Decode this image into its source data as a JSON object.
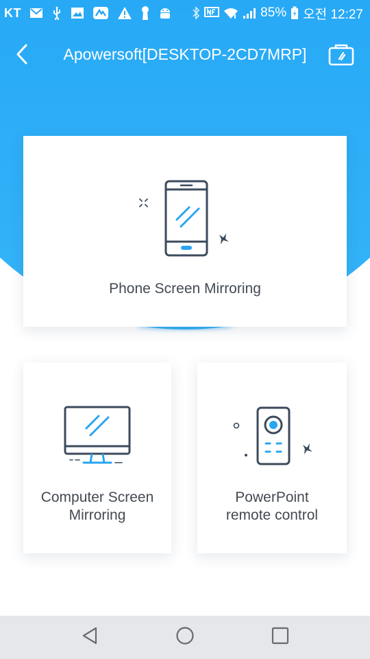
{
  "status_bar": {
    "carrier": "KT",
    "battery": "85%",
    "time": "오전 12:27"
  },
  "app_bar": {
    "title": "Apowersoft[DESKTOP-2CD7MRP]"
  },
  "cards": {
    "phone_mirroring": "Phone Screen Mirroring",
    "computer_mirroring": "Computer Screen\nMirroring",
    "powerpoint_remote": "PowerPoint\nremote control"
  },
  "icons": {
    "back": "back-arrow-icon",
    "cast": "cast-screen-icon",
    "phone": "smartphone-icon",
    "monitor": "monitor-icon",
    "remote": "remote-control-icon"
  },
  "colors": {
    "accent": "#1ea0f5",
    "icon_stroke": "#3c4a5c",
    "icon_accent": "#2aa5f0",
    "nav_bar": "#e6e7eb"
  }
}
